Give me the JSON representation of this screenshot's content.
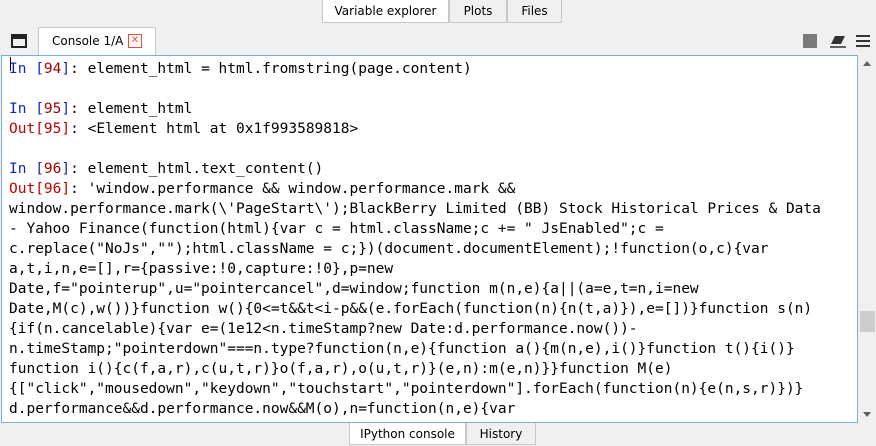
{
  "top_tabs": [
    {
      "label": "Variable explorer",
      "active": true
    },
    {
      "label": "Plots",
      "active": false
    },
    {
      "label": "Files",
      "active": false
    }
  ],
  "console_tab": {
    "label": "Console 1/A",
    "close_icon": "close-icon"
  },
  "toolbar_icons": [
    "window-icon",
    "stop-icon",
    "eraser-icon",
    "menu-icon"
  ],
  "console_lines": [
    {
      "kind": "in",
      "num": "94",
      "text": ": element_html = html.fromstring(page.content)"
    },
    {
      "kind": "blank"
    },
    {
      "kind": "in",
      "num": "95",
      "text": ": element_html"
    },
    {
      "kind": "out",
      "num": "95",
      "text": ": <Element html at 0x1f993589818>"
    },
    {
      "kind": "blank"
    },
    {
      "kind": "in",
      "num": "96",
      "text": ": element_html.text_content()"
    },
    {
      "kind": "out",
      "num": "96",
      "text": ": 'window.performance && window.performance.mark &&"
    },
    {
      "kind": "text",
      "text": "window.performance.mark(\\'PageStart\\');BlackBerry Limited (BB) Stock Historical Prices & Data"
    },
    {
      "kind": "text",
      "text": "- Yahoo Finance(function(html){var c = html.className;c += \" JsEnabled\";c ="
    },
    {
      "kind": "text",
      "text": "c.replace(\"NoJs\",\"\");html.className = c;})(document.documentElement);!function(o,c){var"
    },
    {
      "kind": "text",
      "text": "a,t,i,n,e=[],r={passive:!0,capture:!0},p=new"
    },
    {
      "kind": "text",
      "text": "Date,f=\"pointerup\",u=\"pointercancel\",d=window;function m(n,e){a||(a=e,t=n,i=new"
    },
    {
      "kind": "text",
      "text": "Date,M(c),w())}function w(){0<=t&&t<i-p&&(e.forEach(function(n){n(t,a)}),e=[])}function s(n)"
    },
    {
      "kind": "text",
      "text": "{if(n.cancelable){var e=(1e12<n.timeStamp?new Date:d.performance.now())-"
    },
    {
      "kind": "text",
      "text": "n.timeStamp;\"pointerdown\"===n.type?function(n,e){function a(){m(n,e),i()}function t(){i()}"
    },
    {
      "kind": "text",
      "text": "function i(){c(f,a,r),c(u,t,r)}o(f,a,r),o(u,t,r)}(e,n):m(e,n)}}function M(e)"
    },
    {
      "kind": "text",
      "text": "{[\"click\",\"mousedown\",\"keydown\",\"touchstart\",\"pointerdown\"].forEach(function(n){e(n,s,r)})}"
    },
    {
      "kind": "text",
      "text": "d.performance&&d.performance.now&&M(o),n=function(n,e){var"
    }
  ],
  "prompt_in": "In [",
  "prompt_out": "Out[",
  "prompt_close": "]",
  "bottom_tabs": [
    {
      "label": "IPython console",
      "active": true
    },
    {
      "label": "History",
      "active": false
    }
  ],
  "colors": {
    "in_prompt": "#0f2ab0",
    "in_num": "#a00000",
    "out_prompt": "#c00000",
    "focus_border": "#7aaed6"
  }
}
